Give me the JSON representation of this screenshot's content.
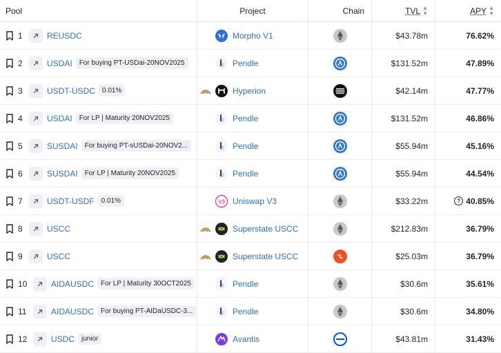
{
  "header": {
    "pool": "Pool",
    "project": "Project",
    "chain": "Chain",
    "tvl": "TVL",
    "apy": "APY"
  },
  "rows": [
    {
      "rank": "1",
      "pool": "REUSDC",
      "badge": "",
      "project": "Morpho V1",
      "project_icon": "morpho-icon",
      "chain_icon": "ethereum-icon",
      "tvl": "$43.78m",
      "apy": "76.62%"
    },
    {
      "rank": "2",
      "pool": "USDAI",
      "badge": "For buying PT-USDai-20NOV2025",
      "project": "Pendle",
      "project_icon": "pendle-icon",
      "chain_icon": "arbitrum-icon",
      "tvl": "$131.52m",
      "apy": "47.89%"
    },
    {
      "rank": "3",
      "pool": "USDT-USDC",
      "badge": "0.01%",
      "project": "Hyperion",
      "project_icon": "hyperion-icon",
      "chain_icon": "aptos-icon",
      "tvl": "$42.14m",
      "apy": "47.77%"
    },
    {
      "rank": "4",
      "pool": "USDAI",
      "badge": "For LP | Maturity 20NOV2025",
      "project": "Pendle",
      "project_icon": "pendle-icon",
      "chain_icon": "arbitrum-icon",
      "tvl": "$131.52m",
      "apy": "46.86%"
    },
    {
      "rank": "5",
      "pool": "SUSDAI",
      "badge": "For buying PT-sUSDai-20NOV2...",
      "project": "Pendle",
      "project_icon": "pendle-icon",
      "chain_icon": "arbitrum-icon",
      "tvl": "$55.94m",
      "apy": "45.16%"
    },
    {
      "rank": "6",
      "pool": "SUSDAI",
      "badge": "For LP | Maturity 20NOV2025",
      "project": "Pendle",
      "project_icon": "pendle-icon",
      "chain_icon": "arbitrum-icon",
      "tvl": "$55.94m",
      "apy": "44.54%"
    },
    {
      "rank": "7",
      "pool": "USDT-USDF",
      "badge": "0.01%",
      "project": "Uniswap V3",
      "project_icon": "uniswap-icon",
      "chain_icon": "ethereum-icon",
      "tvl": "$33.22m",
      "apy": "40.85%"
    },
    {
      "rank": "8",
      "pool": "USCC",
      "badge": "",
      "project": "Superstate USCC",
      "project_icon": "superstate-icon",
      "chain_icon": "ethereum-icon",
      "tvl": "$212.83m",
      "apy": "36.79%"
    },
    {
      "rank": "9",
      "pool": "USCC",
      "badge": "",
      "project": "Superstate USCC",
      "project_icon": "superstate-icon",
      "chain_icon": "plume-icon",
      "tvl": "$25.03m",
      "apy": "36.79%"
    },
    {
      "rank": "10",
      "pool": "AIDAUSDC",
      "badge": "For LP | Maturity 30OCT2025",
      "project": "Pendle",
      "project_icon": "pendle-icon",
      "chain_icon": "ethereum-icon",
      "tvl": "$30.6m",
      "apy": "35.61%"
    },
    {
      "rank": "11",
      "pool": "AIDAUSDC",
      "badge": "For buying PT-AIDaUSDC-3...",
      "project": "Pendle",
      "project_icon": "pendle-icon",
      "chain_icon": "ethereum-icon",
      "tvl": "$30.6m",
      "apy": "34.80%"
    },
    {
      "rank": "12",
      "pool": "USDC",
      "badge": "junior",
      "project": "Avantis",
      "project_icon": "avantis-icon",
      "chain_icon": "base-icon",
      "tvl": "$43.81m",
      "apy": "31.43%"
    }
  ],
  "rwa_rows": [
    3,
    8,
    9
  ],
  "info_rows": [
    7
  ],
  "colors": {
    "link": "#2f6fd4",
    "arbitrum": "#2d74da",
    "plume": "#f04f23",
    "base": "#0052ff",
    "avantis": "#7c3aed"
  }
}
